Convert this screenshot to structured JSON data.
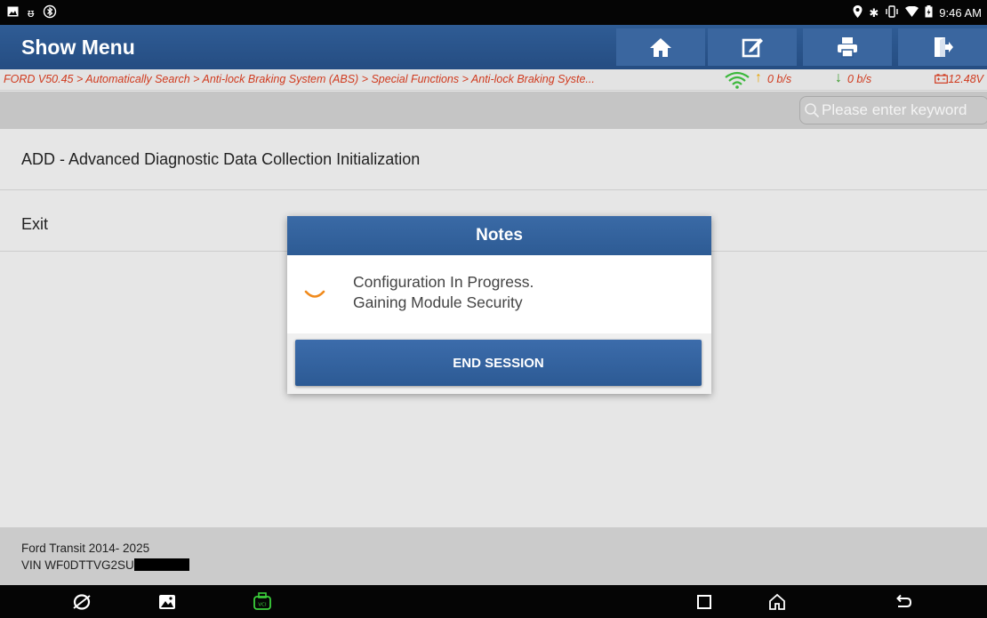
{
  "status_bar": {
    "time": "9:46 AM",
    "left_icons": [
      "gallery-notification-icon",
      "usb-debug-icon",
      "bluetooth-tether-icon"
    ],
    "right_icons": [
      "location-icon",
      "bluetooth-icon",
      "vibrate-icon",
      "wifi-icon",
      "battery-icon"
    ]
  },
  "header": {
    "title": "Show Menu",
    "buttons": [
      "home-icon",
      "edit-report-icon",
      "print-icon",
      "exit-icon"
    ]
  },
  "breadcrumb": {
    "path": "FORD V50.45 > Automatically Search > Anti-lock Braking System (ABS) > Special Functions > Anti-lock Braking Syste...",
    "upload_rate": "0 b/s",
    "download_rate": "0 b/s",
    "voltage": "12.48V"
  },
  "search": {
    "placeholder": "Please enter keyword"
  },
  "menu": {
    "items": [
      {
        "label": "ADD - Advanced Diagnostic Data Collection Initialization"
      },
      {
        "label": "Exit"
      }
    ]
  },
  "vehicle": {
    "model": "Ford Transit 2014- 2025",
    "vin_prefix": "VIN WF0DTTVG2SU"
  },
  "dialog": {
    "title": "Notes",
    "message_line1": "Configuration In Progress.",
    "message_line2": "Gaining Module Security",
    "button_label": "END SESSION"
  },
  "colors": {
    "header_blue": "#2a5690",
    "breadcrumb_red": "#d03a1e",
    "spinner_orange": "#f08a1c",
    "vci_green": "#3bd13b"
  }
}
